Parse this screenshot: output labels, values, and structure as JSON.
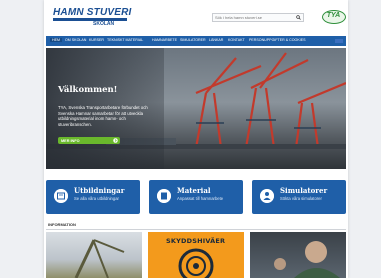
{
  "header": {
    "logo_text": "HAMN STUVERI",
    "logo_sub": "SKOLAN",
    "search_placeholder": "Sök i hela hamn stuveri.se",
    "partner_logo_text": "TYA"
  },
  "nav": {
    "items": [
      {
        "label": "HEM",
        "active": true
      },
      {
        "label": "OM SKOLAN",
        "active": false
      },
      {
        "label": "KURSER",
        "active": false
      },
      {
        "label": "TEKNISKT MATERIAL",
        "active": false
      },
      {
        "label": "HAMNARBETE",
        "active": false
      },
      {
        "label": "SIMULATORER",
        "active": false
      },
      {
        "label": "LÄNKAR",
        "active": false
      },
      {
        "label": "KONTAKT",
        "active": false
      },
      {
        "label": "PERSONUPPGIFTER & COOKIES",
        "active": false
      }
    ]
  },
  "hero": {
    "title": "Välkommen!",
    "text": "TYA, Svenska Transportarbetare förbundet och Svenska Hamnar samarbetar för att utveckla utbildningsmaterial inom hamn- och stuveribranschen.",
    "button_label": "MER INFO"
  },
  "tiles": [
    {
      "title": "Utbildningar",
      "subtitle": "Se alla våra utbildningar",
      "icon": "certificate-icon"
    },
    {
      "title": "Material",
      "subtitle": "Anpassat till hamnarbete",
      "icon": "material-icon"
    },
    {
      "title": "Simulatorer",
      "subtitle": "Sökta våra simulatorer",
      "icon": "person-icon"
    }
  ],
  "info": {
    "label": "INFORMATION",
    "thumb2_title": "SKYDDSHIVÄER"
  },
  "colors": {
    "brand_blue": "#1f5fa8",
    "cta_green": "#6ab82c",
    "partner_green": "#2f8f3b",
    "accent_orange": "#f39a1c"
  }
}
